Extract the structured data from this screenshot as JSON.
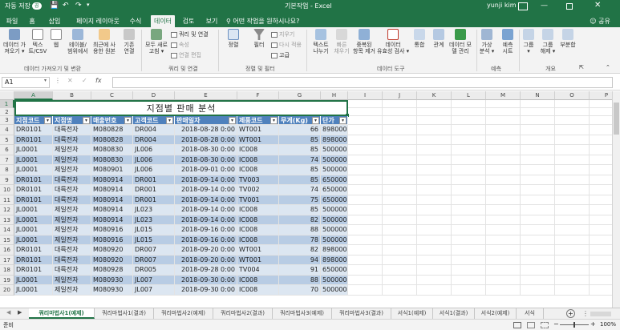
{
  "window": {
    "autosave_label": "자동 저장",
    "autosave_state": "끔",
    "title": "기본작업 - Excel",
    "user": "yunji kim",
    "colors": {
      "brand": "#217346",
      "table_header": "#4f81bd",
      "band_dark": "#b8cce4",
      "band_light": "#dce6f1"
    }
  },
  "tabs": [
    "파일",
    "홈",
    "삽입",
    "페이지 레이아웃",
    "수식",
    "데이터",
    "검토",
    "보기"
  ],
  "active_tab": "데이터",
  "tell_me": "어떤 작업을 원하시나요?",
  "share_label": "공유",
  "ribbon": {
    "get_data_btn": [
      "데이터 가",
      "져오기 ▾"
    ],
    "text_csv_btn": [
      "텍스",
      "트/CSV"
    ],
    "web_btn": [
      "웹",
      ""
    ],
    "table_range_btn": [
      "테이블/",
      "범위에서"
    ],
    "recent_btn": [
      "최근에 사",
      "용한 원본"
    ],
    "existing_btn": [
      "기존",
      "연결"
    ],
    "group_get": "데이터 가져오기 및 변환",
    "refresh_btn": [
      "모두 새로",
      "고침 ▾"
    ],
    "queries_conn": "쿼리 및 연결",
    "properties": "속성",
    "edit_links": "연결 편집",
    "group_query": "쿼리 및 연결",
    "sort_btn": [
      "정렬",
      ""
    ],
    "filter_btn": [
      "필터",
      ""
    ],
    "clear": "지우기",
    "reapply": "다시 적용",
    "advanced": "고급",
    "group_sort": "정렬 및 필터",
    "text_to_cols_btn": [
      "텍스트",
      "나누기"
    ],
    "flash_fill_btn": [
      "빠른",
      "채우기"
    ],
    "remove_dup_btn": [
      "중복된",
      "항목 제거"
    ],
    "validation_btn": [
      "데이터",
      "유효성 검사 ▾"
    ],
    "consolidate_btn": [
      "통합",
      ""
    ],
    "relations_btn": [
      "관계",
      ""
    ],
    "data_model_btn": [
      "데이터 모",
      "델 관리"
    ],
    "group_tools": "데이터 도구",
    "what_if_btn": [
      "가상",
      "분석 ▾"
    ],
    "forecast_btn": [
      "예측",
      "시트"
    ],
    "group_forecast": "예측",
    "group_btn": [
      "그룹",
      "▾"
    ],
    "ungroup_btn": [
      "그룹",
      "해제 ▾"
    ],
    "subtotal_btn": [
      "부분합",
      ""
    ],
    "group_outline": "개요"
  },
  "formula_bar": {
    "name_box": "A1",
    "fx": "fx",
    "formula": ""
  },
  "columns": [
    "A",
    "B",
    "C",
    "D",
    "E",
    "F",
    "G",
    "H",
    "I",
    "J",
    "K",
    "L",
    "M",
    "N",
    "O",
    "P"
  ],
  "title_cell": "지점별 판매 분석",
  "table": {
    "headers": [
      "지점코드",
      "지점명",
      "매출번호",
      "고객코드",
      "판매일자",
      "제품코드",
      "무게(Kg)",
      "단가"
    ],
    "rows": [
      [
        "DR0101",
        "대륙전자",
        "M080828",
        "DR004",
        "2018-08-28 0:00",
        "WT001",
        "66",
        "898000"
      ],
      [
        "DR0101",
        "대륙전자",
        "M080828",
        "DR004",
        "2018-08-28 0:00",
        "WT001",
        "85",
        "898000"
      ],
      [
        "JL0001",
        "제일전자",
        "M080830",
        "JL006",
        "2018-08-30 0:00",
        "IC008",
        "85",
        "500000"
      ],
      [
        "JL0001",
        "제일전자",
        "M080830",
        "JL006",
        "2018-08-30 0:00",
        "IC008",
        "74",
        "500000"
      ],
      [
        "JL0001",
        "제일전자",
        "M080901",
        "JL006",
        "2018-09-01 0:00",
        "IC008",
        "85",
        "500000"
      ],
      [
        "DR0101",
        "대륙전자",
        "M080914",
        "DR001",
        "2018-09-14 0:00",
        "TV003",
        "85",
        "650000"
      ],
      [
        "DR0101",
        "대륙전자",
        "M080914",
        "DR001",
        "2018-09-14 0:00",
        "TV002",
        "74",
        "650000"
      ],
      [
        "DR0101",
        "대륙전자",
        "M080914",
        "DR001",
        "2018-09-14 0:00",
        "TV001",
        "75",
        "650000"
      ],
      [
        "JL0001",
        "제일전자",
        "M080914",
        "JL023",
        "2018-09-14 0:00",
        "IC008",
        "85",
        "500000"
      ],
      [
        "JL0001",
        "제일전자",
        "M080914",
        "JL023",
        "2018-09-14 0:00",
        "IC008",
        "82",
        "500000"
      ],
      [
        "JL0001",
        "제일전자",
        "M080916",
        "JL015",
        "2018-09-16 0:00",
        "IC008",
        "88",
        "500000"
      ],
      [
        "JL0001",
        "제일전자",
        "M080916",
        "JL015",
        "2018-09-16 0:00",
        "IC008",
        "78",
        "500000"
      ],
      [
        "DR0101",
        "대륙전자",
        "M080920",
        "DR007",
        "2018-09-20 0:00",
        "WT001",
        "82",
        "898000"
      ],
      [
        "DR0101",
        "대륙전자",
        "M080920",
        "DR007",
        "2018-09-20 0:00",
        "WT001",
        "94",
        "898000"
      ],
      [
        "DR0101",
        "대륙전자",
        "M080928",
        "DR005",
        "2018-09-28 0:00",
        "TV004",
        "91",
        "650000"
      ],
      [
        "JL0001",
        "제일전자",
        "M080930",
        "JL007",
        "2018-09-30 0:00",
        "IC008",
        "88",
        "500000"
      ],
      [
        "JL0001",
        "제일전자",
        "M080930",
        "JL007",
        "2018-09-30 0:00",
        "IC008",
        "70",
        "500000"
      ]
    ]
  },
  "row_numbers": [
    "1",
    "2",
    "3",
    "4",
    "5",
    "6",
    "7",
    "8",
    "9",
    "10",
    "11",
    "12",
    "13",
    "14",
    "15",
    "16",
    "17",
    "18",
    "19",
    "20"
  ],
  "sheet_tabs": [
    "쿼리마법사1(예제)",
    "쿼리마법사1(결과)",
    "쿼리마법사2(예제)",
    "쿼리마법사2(결과)",
    "쿼리마법사3(예제)",
    "쿼리마법사3(결과)",
    "서식1(예제)",
    "서식1(결과)",
    "서식2(예제)",
    "서식"
  ],
  "active_sheet": 0,
  "status": {
    "mode": "준비",
    "zoom": "100%"
  }
}
